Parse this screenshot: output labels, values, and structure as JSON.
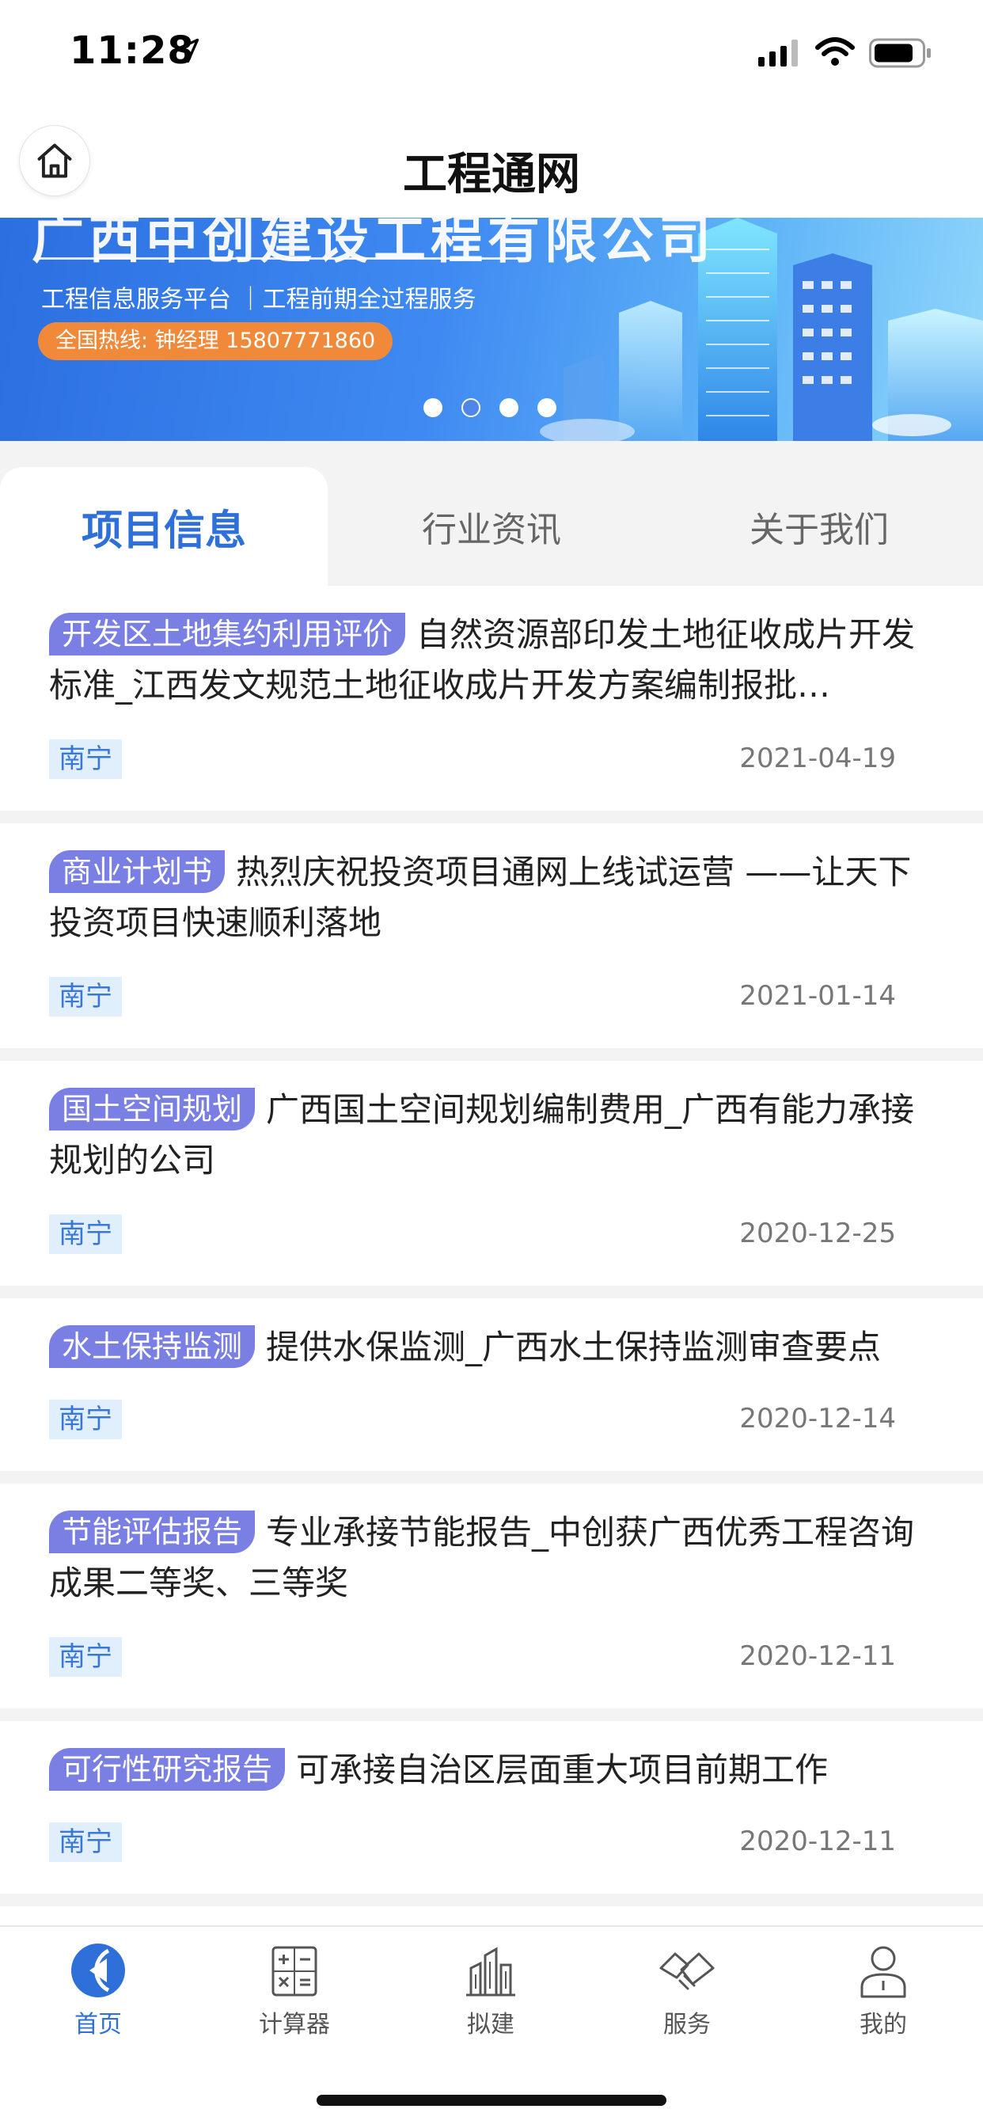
{
  "status_bar": {
    "time": "11:28"
  },
  "nav": {
    "title": "工程通网"
  },
  "banner": {
    "company": "广西中创建设工程有限公司",
    "subtitle": "工程信息服务平台 ｜工程前期全过程服务",
    "hotline": "全国热线: 钟经理 15807771860",
    "active_dot": 2
  },
  "tabs": [
    {
      "label": "项目信息",
      "active": true
    },
    {
      "label": "行业资讯",
      "active": false
    },
    {
      "label": "关于我们",
      "active": false
    }
  ],
  "items": [
    {
      "category": "开发区土地集约利用评价",
      "title": "自然资源部印发土地征收成片开发标准_江西发文规范土地征收成片开发方案编制报批…",
      "city": "南宁",
      "date": "2021-04-19"
    },
    {
      "category": "商业计划书",
      "title": "热烈庆祝投资项目通网上线试运营 ——让天下投资项目快速顺利落地",
      "city": "南宁",
      "date": "2021-01-14"
    },
    {
      "category": "国土空间规划",
      "title": "广西国土空间规划编制费用_广西有能力承接规划的公司",
      "city": "南宁",
      "date": "2020-12-25"
    },
    {
      "category": "水土保持监测",
      "title": "提供水保监测_广西水土保持监测审查要点",
      "city": "南宁",
      "date": "2020-12-14"
    },
    {
      "category": "节能评估报告",
      "title": "专业承接节能报告_中创获广西优秀工程咨询成果二等奖、三等奖",
      "city": "南宁",
      "date": "2020-12-11"
    },
    {
      "category": "可行性研究报告",
      "title": "可承接自治区层面重大项目前期工作",
      "city": "南宁",
      "date": "2020-12-11"
    }
  ],
  "tabbar": [
    {
      "label": "首页",
      "icon": "home-arrow-icon",
      "active": true
    },
    {
      "label": "计算器",
      "icon": "calculator-icon",
      "active": false
    },
    {
      "label": "拟建",
      "icon": "buildings-icon",
      "active": false
    },
    {
      "label": "服务",
      "icon": "handshake-icon",
      "active": false
    },
    {
      "label": "我的",
      "icon": "user-icon",
      "active": false
    }
  ],
  "colors": {
    "accent": "#2f6fd9",
    "tag": "#7a7fe3",
    "city_tag_bg": "#e1eefc",
    "hotline": "#f08a3a"
  }
}
